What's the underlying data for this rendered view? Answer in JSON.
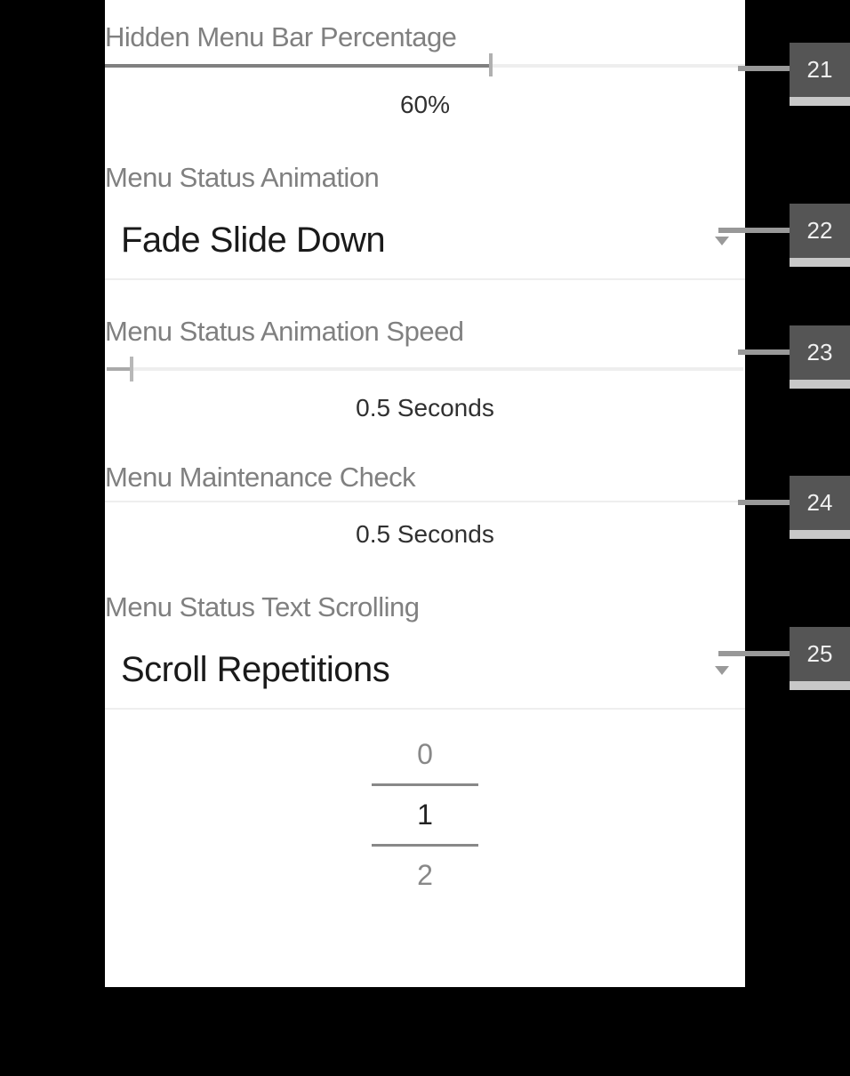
{
  "sections": {
    "hiddenMenuBar": {
      "label": "Hidden Menu Bar Percentage",
      "value": "60%",
      "fillPercent": 60
    },
    "statusAnimation": {
      "label": "Menu Status Animation",
      "value": "Fade Slide Down"
    },
    "animationSpeed": {
      "label": "Menu Status Animation Speed",
      "value": "0.5 Seconds"
    },
    "maintenanceCheck": {
      "label": "Menu Maintenance Check",
      "value": "0.5 Seconds"
    },
    "textScrolling": {
      "label": "Menu Status Text Scrolling",
      "value": "Scroll Repetitions"
    },
    "picker": {
      "prev": "0",
      "current": "1",
      "next": "2"
    }
  },
  "badges": {
    "b21": "21",
    "b22": "22",
    "b23": "23",
    "b24": "24",
    "b25": "25"
  }
}
